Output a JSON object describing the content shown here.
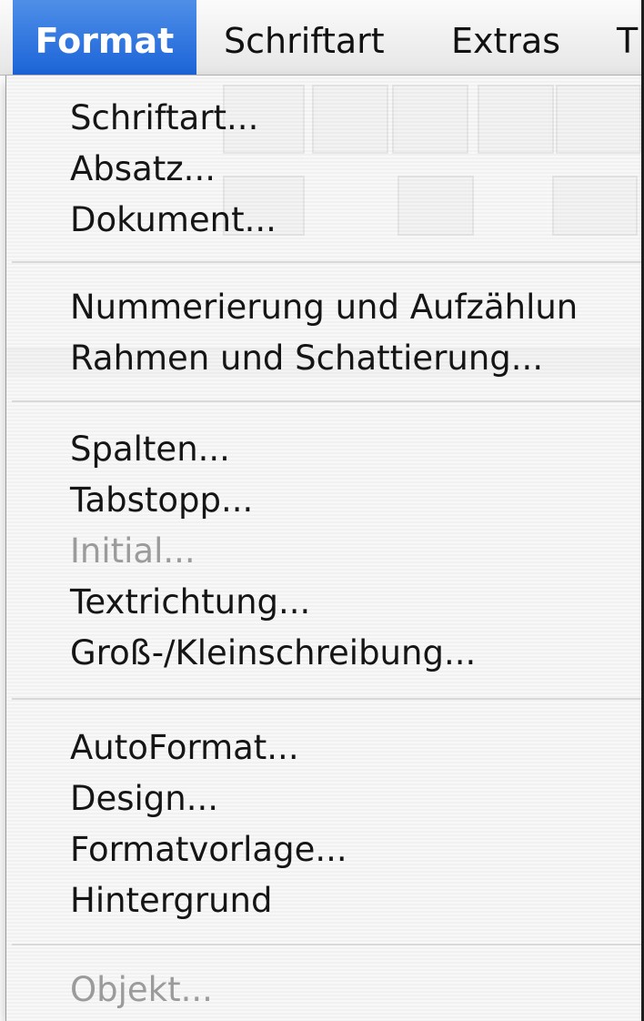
{
  "menubar": {
    "items": [
      {
        "label": "Format",
        "active": true
      },
      {
        "label": "Schriftart",
        "active": false
      },
      {
        "label": "Extras",
        "active": false
      },
      {
        "label": "T",
        "active": false
      }
    ]
  },
  "menu": {
    "items": [
      {
        "label": "Schriftart...",
        "enabled": true
      },
      {
        "label": "Absatz...",
        "enabled": true
      },
      {
        "label": "Dokument...",
        "enabled": true
      },
      {
        "label": "Nummerierung und Aufzählun",
        "enabled": true
      },
      {
        "label": "Rahmen und Schattierung...",
        "enabled": true
      },
      {
        "label": "Spalten...",
        "enabled": true
      },
      {
        "label": "Tabstopp...",
        "enabled": true
      },
      {
        "label": "Initial...",
        "enabled": false
      },
      {
        "label": "Textrichtung...",
        "enabled": true
      },
      {
        "label": "Groß-/Kleinschreibung...",
        "enabled": true
      },
      {
        "label": "AutoFormat...",
        "enabled": true
      },
      {
        "label": "Design...",
        "enabled": true
      },
      {
        "label": "Formatvorlage...",
        "enabled": true
      },
      {
        "label": "Hintergrund",
        "enabled": true
      },
      {
        "label": "Objekt...",
        "enabled": false
      }
    ]
  },
  "colors": {
    "highlight": "#1c64d8",
    "menu_text": "#151515",
    "disabled_text": "#9b9b9b"
  }
}
